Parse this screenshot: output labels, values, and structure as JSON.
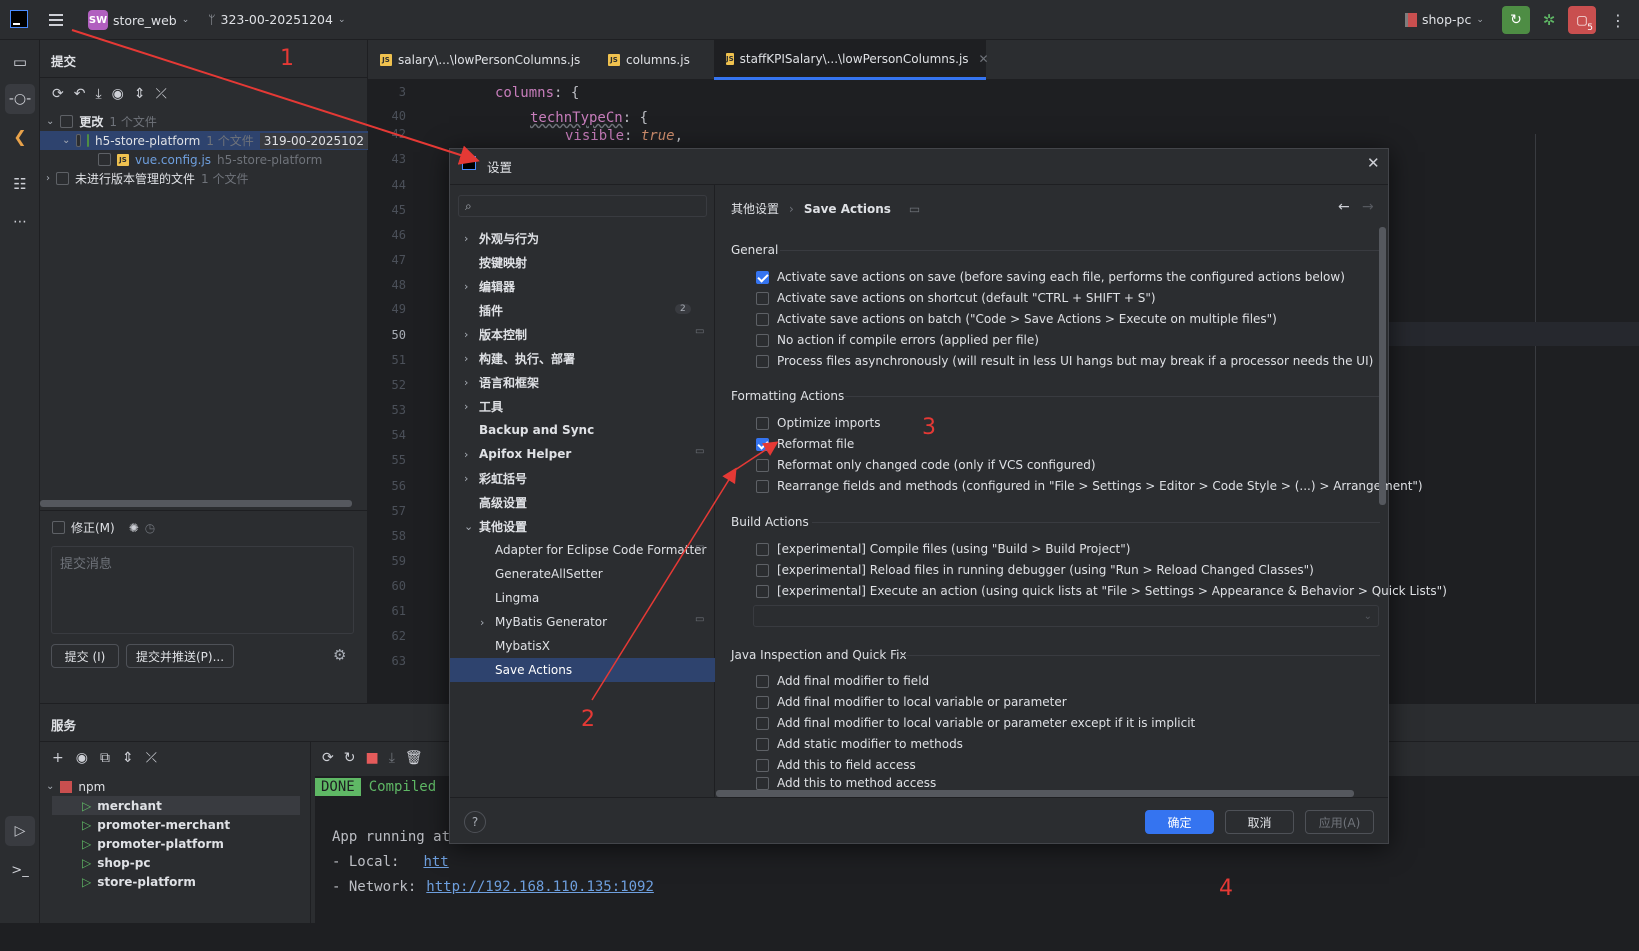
{
  "titlebar": {
    "project_badge": "SW",
    "project_name": "store_web",
    "branch": "323-00-20251204",
    "run_config": "shop-pc",
    "notification_count": "5"
  },
  "commit_panel": {
    "title": "提交",
    "changes_label": "更改",
    "changes_count": "1 个文件",
    "module_name": "h5-store-platform",
    "module_count": "1 个文件",
    "module_branch": "319-00-2025102",
    "file_name": "vue.config.js",
    "file_module": "h5-store-platform",
    "unversioned_label": "未进行版本管理的文件",
    "unversioned_count": "1 个文件",
    "amend_label": "修正(M)",
    "message_placeholder": "提交消息",
    "commit_button": "提交 (I)",
    "commit_push_button": "提交并推送(P)..."
  },
  "editor": {
    "tabs": [
      {
        "label": "salary\\...\\lowPersonColumns.js"
      },
      {
        "label": "columns.js"
      },
      {
        "label": "staffKPISalary\\...\\lowPersonColumns.js"
      }
    ],
    "line_numbers": [
      "3",
      "40",
      "42",
      "43",
      "44",
      "45",
      "46",
      "47",
      "48",
      "49",
      "50",
      "51",
      "52",
      "53",
      "54",
      "55",
      "56",
      "57",
      "58",
      "59",
      "60",
      "61",
      "62",
      "63"
    ],
    "code_columns": "columns",
    "code_techn": "technTypeCn",
    "code_visible": "visible",
    "code_true": "true"
  },
  "services": {
    "title": "服务",
    "npm_label": "npm",
    "items": [
      "merchant",
      "promoter-merchant",
      "promoter-platform",
      "shop-pc",
      "store-platform"
    ],
    "done_badge": "DONE",
    "compiled_text": "Compiled",
    "app_running": "App running at",
    "local_label": "- Local:",
    "local_url": "htt",
    "network_label": "- Network:",
    "network_url": "http://192.168.110.135:1092"
  },
  "dialog": {
    "title": "设置",
    "search_placeholder": "",
    "nav": [
      {
        "label": "外观与行为",
        "expand": "›"
      },
      {
        "label": "按键映射",
        "expand": ""
      },
      {
        "label": "编辑器",
        "expand": "›"
      },
      {
        "label": "插件",
        "expand": "",
        "badge": "2"
      },
      {
        "label": "版本控制",
        "expand": "›"
      },
      {
        "label": "构建、执行、部署",
        "expand": "›"
      },
      {
        "label": "语言和框架",
        "expand": "›"
      },
      {
        "label": "工具",
        "expand": "›"
      },
      {
        "label": "Backup and Sync",
        "expand": ""
      },
      {
        "label": "Apifox Helper",
        "expand": "›"
      },
      {
        "label": "彩虹括号",
        "expand": "›"
      },
      {
        "label": "高级设置",
        "expand": ""
      },
      {
        "label": "其他设置",
        "expand": "⌄"
      },
      {
        "label": "Adapter for Eclipse Code Formatter",
        "expand": ""
      },
      {
        "label": "GenerateAllSetter",
        "expand": ""
      },
      {
        "label": "Lingma",
        "expand": ""
      },
      {
        "label": "MyBatis Generator",
        "expand": "›"
      },
      {
        "label": "MybatisX",
        "expand": ""
      },
      {
        "label": "Save Actions",
        "expand": ""
      }
    ],
    "breadcrumb_parent": "其他设置",
    "breadcrumb_sep": "›",
    "breadcrumb_current": "Save Actions",
    "sections": {
      "general": "General",
      "formatting": "Formatting Actions",
      "build": "Build Actions",
      "java": "Java Inspection and Quick Fix"
    },
    "general_options": [
      {
        "label": "Activate save actions on save (before saving each file, performs the configured actions below)",
        "checked": true
      },
      {
        "label": "Activate save actions on shortcut (default \"CTRL + SHIFT + S\")",
        "checked": false
      },
      {
        "label": "Activate save actions on batch (\"Code > Save Actions > Execute on multiple files\")",
        "checked": false
      },
      {
        "label": "No action if compile errors (applied per file)",
        "checked": false
      },
      {
        "label": "Process files asynchronously (will result in less UI hangs but may break if a processor needs the UI)",
        "checked": false
      }
    ],
    "formatting_options": [
      {
        "label": "Optimize imports",
        "checked": false
      },
      {
        "label": "Reformat file",
        "checked": true
      },
      {
        "label": "Reformat only changed code (only if VCS configured)",
        "checked": false
      },
      {
        "label": "Rearrange fields and methods (configured in \"File > Settings > Editor > Code Style > (...) > Arrangement\")",
        "checked": false
      }
    ],
    "build_options": [
      {
        "label": "[experimental] Compile files (using \"Build > Build Project\")",
        "checked": false
      },
      {
        "label": "[experimental] Reload files in running debugger (using \"Run > Reload Changed Classes\")",
        "checked": false
      },
      {
        "label": "[experimental] Execute an action (using quick lists at \"File > Settings > Appearance & Behavior > Quick Lists\")",
        "checked": false
      }
    ],
    "java_options": [
      {
        "label": "Add final modifier to field",
        "checked": false
      },
      {
        "label": "Add final modifier to local variable or parameter",
        "checked": false
      },
      {
        "label": "Add final modifier to local variable or parameter except if it is implicit",
        "checked": false
      },
      {
        "label": "Add static modifier to methods",
        "checked": false
      },
      {
        "label": "Add this to field access",
        "checked": false
      },
      {
        "label": "Add this to method access",
        "checked": false
      }
    ],
    "ok_button": "确定",
    "cancel_button": "取消",
    "apply_button": "应用(A)",
    "help_button": "?"
  },
  "annotations": [
    "1",
    "2",
    "3",
    "4"
  ],
  "colors": {
    "accent": "#3574f0",
    "annotation": "#e53935",
    "selection": "#2e436e"
  }
}
